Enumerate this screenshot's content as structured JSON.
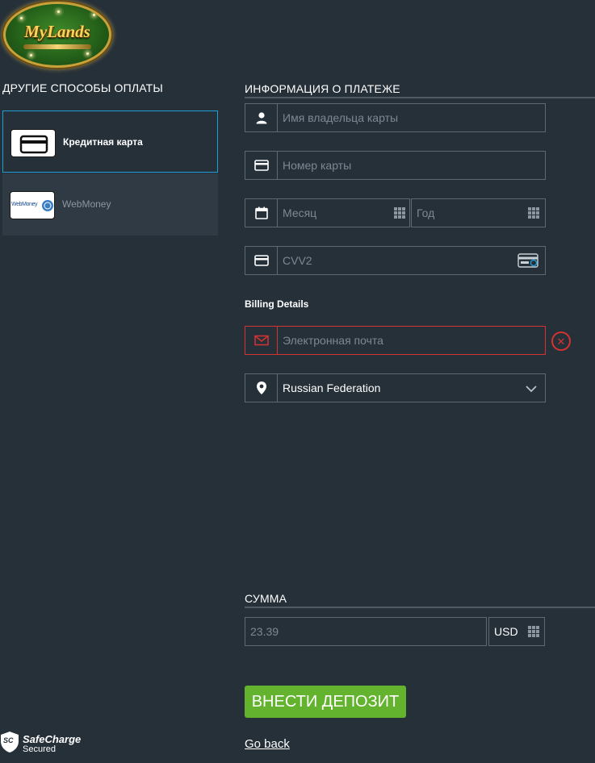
{
  "logo": {
    "text": "MyLands"
  },
  "left": {
    "title": "ДРУГИЕ СПОСОБЫ ОПЛАТЫ",
    "methods": [
      {
        "label": "Кредитная карта",
        "icon": "credit-card-icon",
        "active": true
      },
      {
        "label": "WebMoney",
        "icon": "webmoney-logo",
        "logo_text": "WebMoney",
        "active": false
      }
    ]
  },
  "payment": {
    "title": "ИНФОРМАЦИЯ О ПЛАТЕЖЕ",
    "cardholder_placeholder": "Имя владельца карты",
    "card_number_placeholder": "Номер карты",
    "month_placeholder": "Месяц",
    "year_placeholder": "Год",
    "cvv_placeholder": "CVV2"
  },
  "billing": {
    "title": "Billing Details",
    "email_placeholder": "Электронная почта",
    "error_mark": "✕",
    "country": "Russian Federation"
  },
  "amount": {
    "title": "СУММА",
    "value": "23.39",
    "currency": "USD"
  },
  "actions": {
    "deposit_label": "ВНЕСТИ ДЕПОЗИТ",
    "go_back_label": "Go back"
  },
  "footer": {
    "badge_letters": "SC",
    "brand": "SafeCharge",
    "secured": "Secured"
  },
  "colors": {
    "background": "#263039",
    "accent_blue": "#1e9fd8",
    "error_red": "#d63232",
    "deposit_green": "#63b32e"
  }
}
